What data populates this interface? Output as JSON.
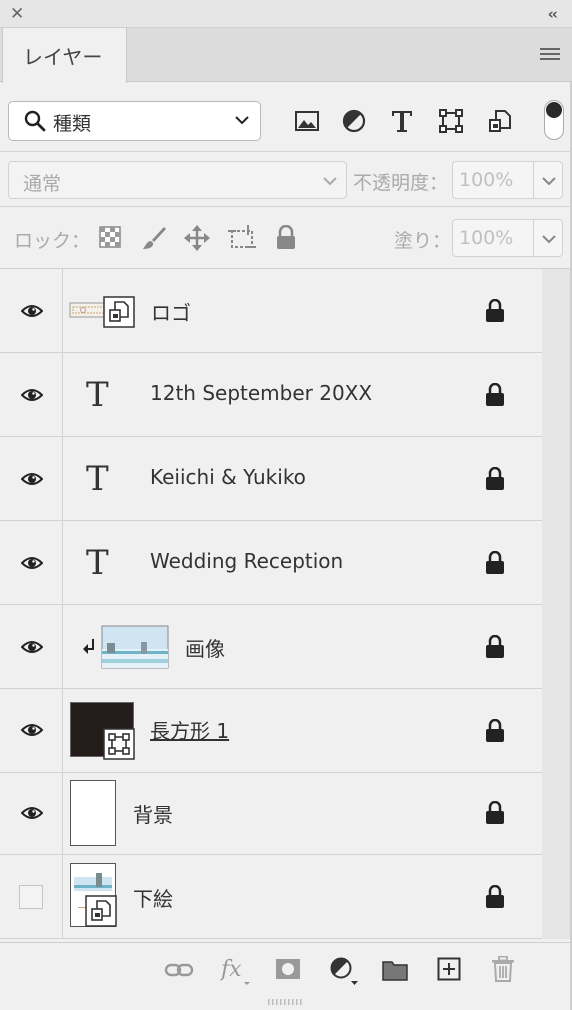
{
  "panel": {
    "tab_label": "レイヤー"
  },
  "filter": {
    "kind_label": "種類",
    "filter_icons": [
      "image-filter-icon",
      "adjustment-filter-icon",
      "type-filter-icon",
      "shape-filter-icon",
      "smart-object-filter-icon"
    ]
  },
  "blend": {
    "mode": "通常",
    "opacity_label": "不透明度：",
    "opacity_value": "100%"
  },
  "lock": {
    "label": "ロック：",
    "fill_label": "塗り：",
    "fill_value": "100%"
  },
  "layers": [
    {
      "name": "ロゴ",
      "visible": true,
      "kind": "smart-object"
    },
    {
      "name": "12th September 20XX",
      "visible": true,
      "kind": "text"
    },
    {
      "name": "Keiichi & Yukiko",
      "visible": true,
      "kind": "text"
    },
    {
      "name": "Wedding Reception",
      "visible": true,
      "kind": "text"
    },
    {
      "name": "画像",
      "visible": true,
      "kind": "image",
      "clipped": true
    },
    {
      "name": "長方形 1",
      "visible": true,
      "kind": "shape"
    },
    {
      "name": "背景",
      "visible": true,
      "kind": "background"
    },
    {
      "name": "下絵",
      "visible": false,
      "kind": "smart-object"
    }
  ],
  "footer_icons": [
    "link-icon",
    "fx-icon",
    "mask-icon",
    "adjustment-icon",
    "folder-icon",
    "new-layer-icon",
    "trash-icon"
  ],
  "colors": {
    "panel_bg": "#f0f0f0",
    "shape_fill": "#231c1b"
  }
}
